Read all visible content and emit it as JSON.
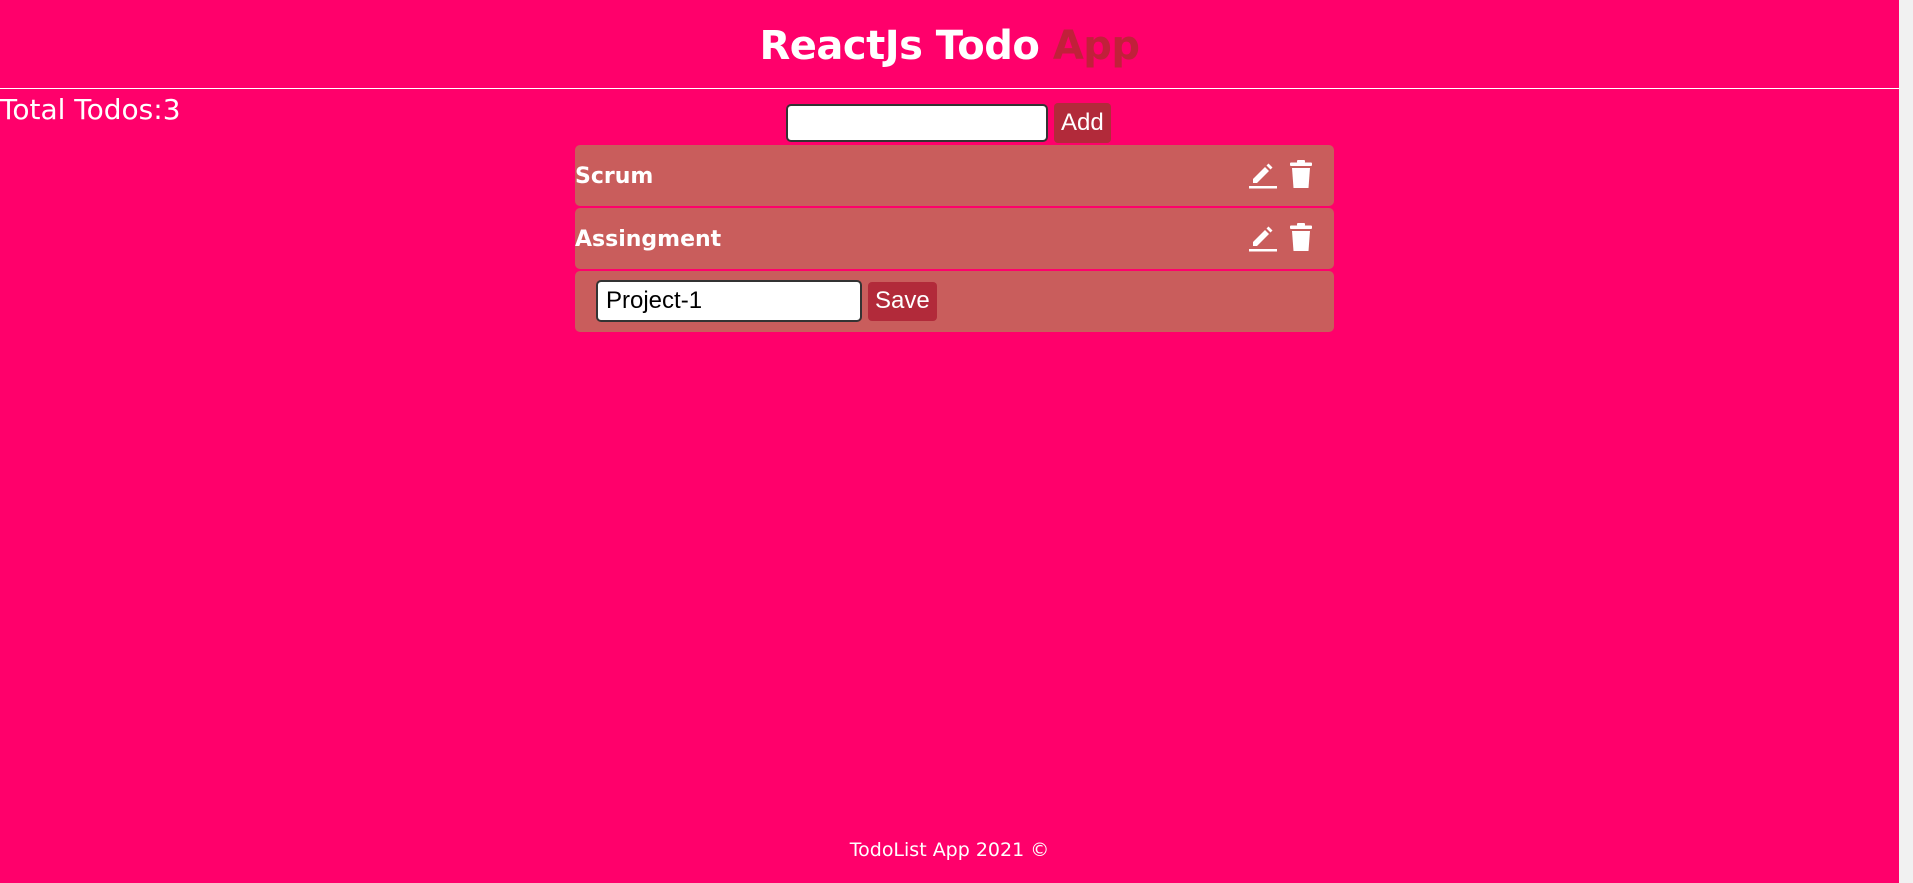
{
  "header": {
    "title_main": "ReactJs Todo",
    "title_accent": "App"
  },
  "counter": {
    "text": "Total Todos:3"
  },
  "add_form": {
    "input_value": "",
    "button_label": "Add"
  },
  "todos": [
    {
      "label": "Scrum"
    },
    {
      "label": "Assingment"
    }
  ],
  "edit_form": {
    "input_value": "Project-1",
    "button_label": "Save"
  },
  "footer": {
    "text": "TodoList App 2021 ©"
  },
  "icons": {
    "edit": "pencil-icon",
    "delete": "trash-icon"
  },
  "colors": {
    "background": "#ff006b",
    "accent": "#c1203a",
    "item_background": "#c95d5c",
    "button": "#b22a3a"
  }
}
